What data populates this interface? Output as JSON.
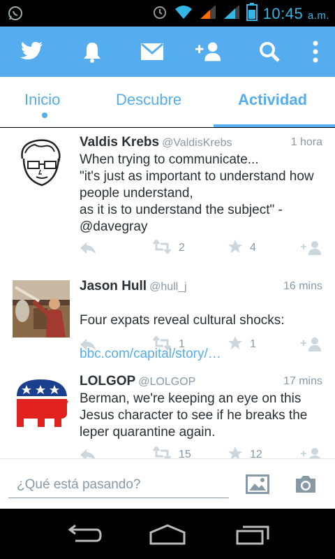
{
  "status_bar": {
    "time": "10:45",
    "ampm": "a.m.",
    "icons": [
      "whatsapp-icon",
      "alarm-icon",
      "wifi-icon",
      "signal-1-icon",
      "signal-2-icon",
      "battery-icon"
    ]
  },
  "app_bar": {
    "icons": [
      "twitter-bird-icon",
      "notifications-bell-icon",
      "messages-envelope-icon",
      "add-user-icon",
      "search-icon",
      "overflow-menu-icon"
    ],
    "color": "#55acee"
  },
  "tabs": [
    {
      "label": "Inicio"
    },
    {
      "label": "Descubre"
    },
    {
      "label": "Actividad"
    }
  ],
  "tweets": [
    {
      "name": "Valdis Krebs",
      "handle": "@ValdisKrebs",
      "time": "1 hora",
      "text": "When trying to communicate...\n\"it's just as important to understand how people understand,\nas it is to understand the subject\" - @davegray",
      "retweets": "2",
      "favorites": "4"
    },
    {
      "name": "Jason Hull",
      "handle": "@hull_j",
      "time": "16 mins",
      "text": "Four expats reveal cultural shocks:",
      "link": "bbc.com/capital/story/…",
      "retweets": "1",
      "favorites": "1"
    },
    {
      "name": "LOLGOP",
      "handle": "@LOLGOP",
      "time": "17 mins",
      "text": "Berman, we're keeping an eye on this Jesus character to see if he breaks the leper quarantine again.",
      "retweets": "15",
      "favorites": "12"
    }
  ],
  "compose": {
    "placeholder": "¿Qué está pasando?",
    "icons": [
      "image-icon",
      "camera-icon"
    ]
  },
  "nav_bar": {
    "icons": [
      "back-icon",
      "home-icon",
      "recent-apps-icon"
    ]
  }
}
